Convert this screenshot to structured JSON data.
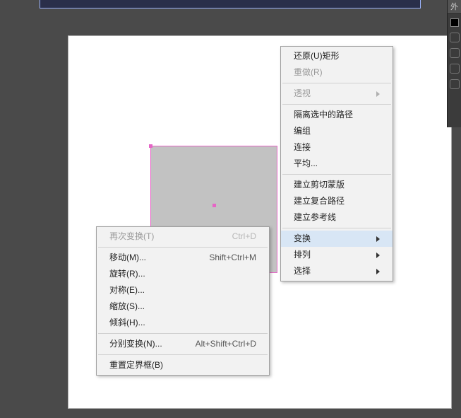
{
  "side_panel": {
    "tab_label": "外"
  },
  "primary_menu": {
    "items": [
      {
        "label": "还原(U)矩形",
        "disabled": false,
        "sep_after": false
      },
      {
        "label": "重做(R)",
        "disabled": true,
        "sep_after": true
      },
      {
        "label": "透视",
        "disabled": true,
        "arrow": true,
        "sep_after": true
      },
      {
        "label": "隔离选中的路径",
        "disabled": false,
        "sep_after": false
      },
      {
        "label": "编组",
        "disabled": false,
        "sep_after": false
      },
      {
        "label": "连接",
        "disabled": false,
        "sep_after": false
      },
      {
        "label": "平均...",
        "disabled": false,
        "sep_after": true
      },
      {
        "label": "建立剪切蒙版",
        "disabled": false,
        "sep_after": false
      },
      {
        "label": "建立复合路径",
        "disabled": false,
        "sep_after": false
      },
      {
        "label": "建立参考线",
        "disabled": false,
        "sep_after": true
      },
      {
        "label": "变换",
        "disabled": false,
        "arrow": true,
        "highlight": true,
        "sep_after": false
      },
      {
        "label": "排列",
        "disabled": false,
        "arrow": true,
        "sep_after": false
      },
      {
        "label": "选择",
        "disabled": false,
        "arrow": true,
        "sep_after": false
      }
    ]
  },
  "sub_menu": {
    "items": [
      {
        "label": "再次变换(T)",
        "shortcut": "Ctrl+D",
        "disabled": true,
        "sep_after": true
      },
      {
        "label": "移动(M)...",
        "shortcut": "Shift+Ctrl+M",
        "disabled": false,
        "sep_after": false
      },
      {
        "label": "旋转(R)...",
        "disabled": false,
        "sep_after": false
      },
      {
        "label": "对称(E)...",
        "disabled": false,
        "sep_after": false
      },
      {
        "label": "缩放(S)...",
        "disabled": false,
        "sep_after": false
      },
      {
        "label": "倾斜(H)...",
        "disabled": false,
        "sep_after": true
      },
      {
        "label": "分别变换(N)...",
        "shortcut": "Alt+Shift+Ctrl+D",
        "disabled": false,
        "sep_after": true
      },
      {
        "label": "重置定界框(B)",
        "disabled": false,
        "sep_after": false
      }
    ]
  }
}
